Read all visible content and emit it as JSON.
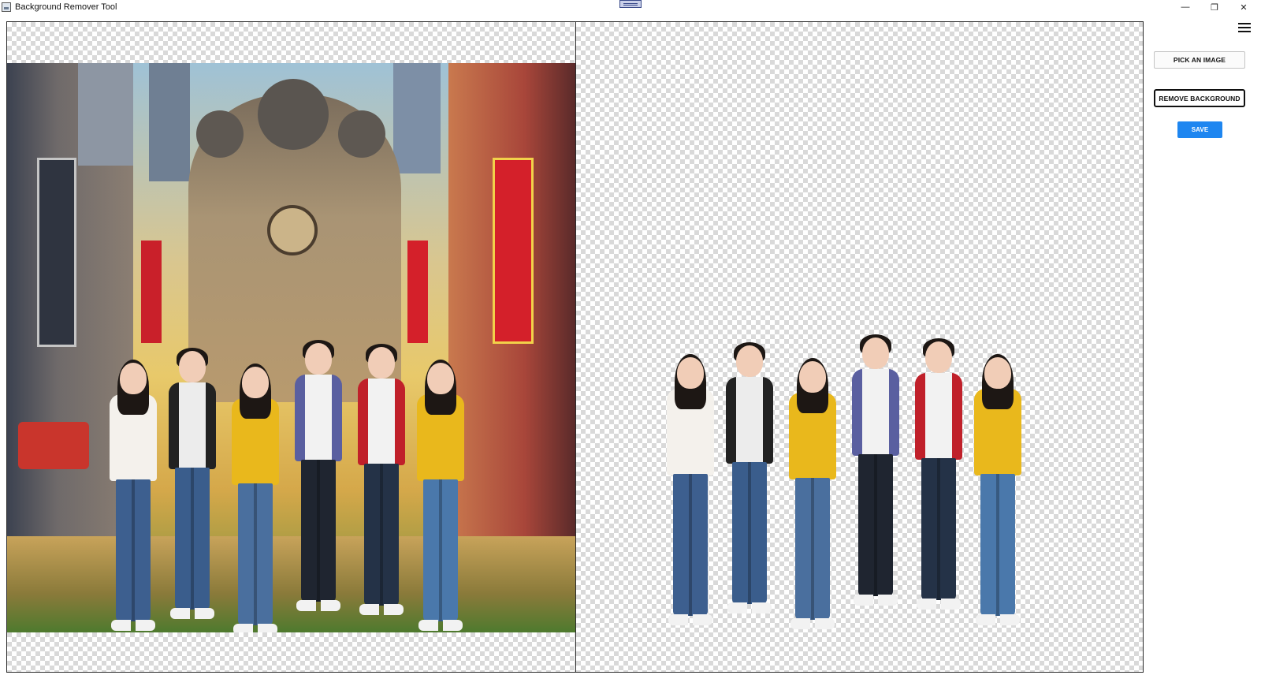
{
  "window": {
    "title": "Background Remover Tool",
    "controls": {
      "minimize": "—",
      "maximize": "❐",
      "close": "✕"
    }
  },
  "icons": {
    "app": "app-icon",
    "drag_handle": "drag-handle-icon",
    "menu": "hamburger-menu-icon"
  },
  "panels": {
    "original": {
      "content": "original-image",
      "background": "transparent-checkerboard"
    },
    "result": {
      "content": "background-removed-image",
      "background": "transparent-checkerboard"
    }
  },
  "sidebar": {
    "pick_label": "PICK AN IMAGE",
    "remove_label": "REMOVE BACKGROUND",
    "save_label": "SAVE"
  },
  "colors": {
    "save_button": "#1e86f0",
    "checker_light": "#ffffff",
    "checker_dark": "#d9d9d9"
  }
}
